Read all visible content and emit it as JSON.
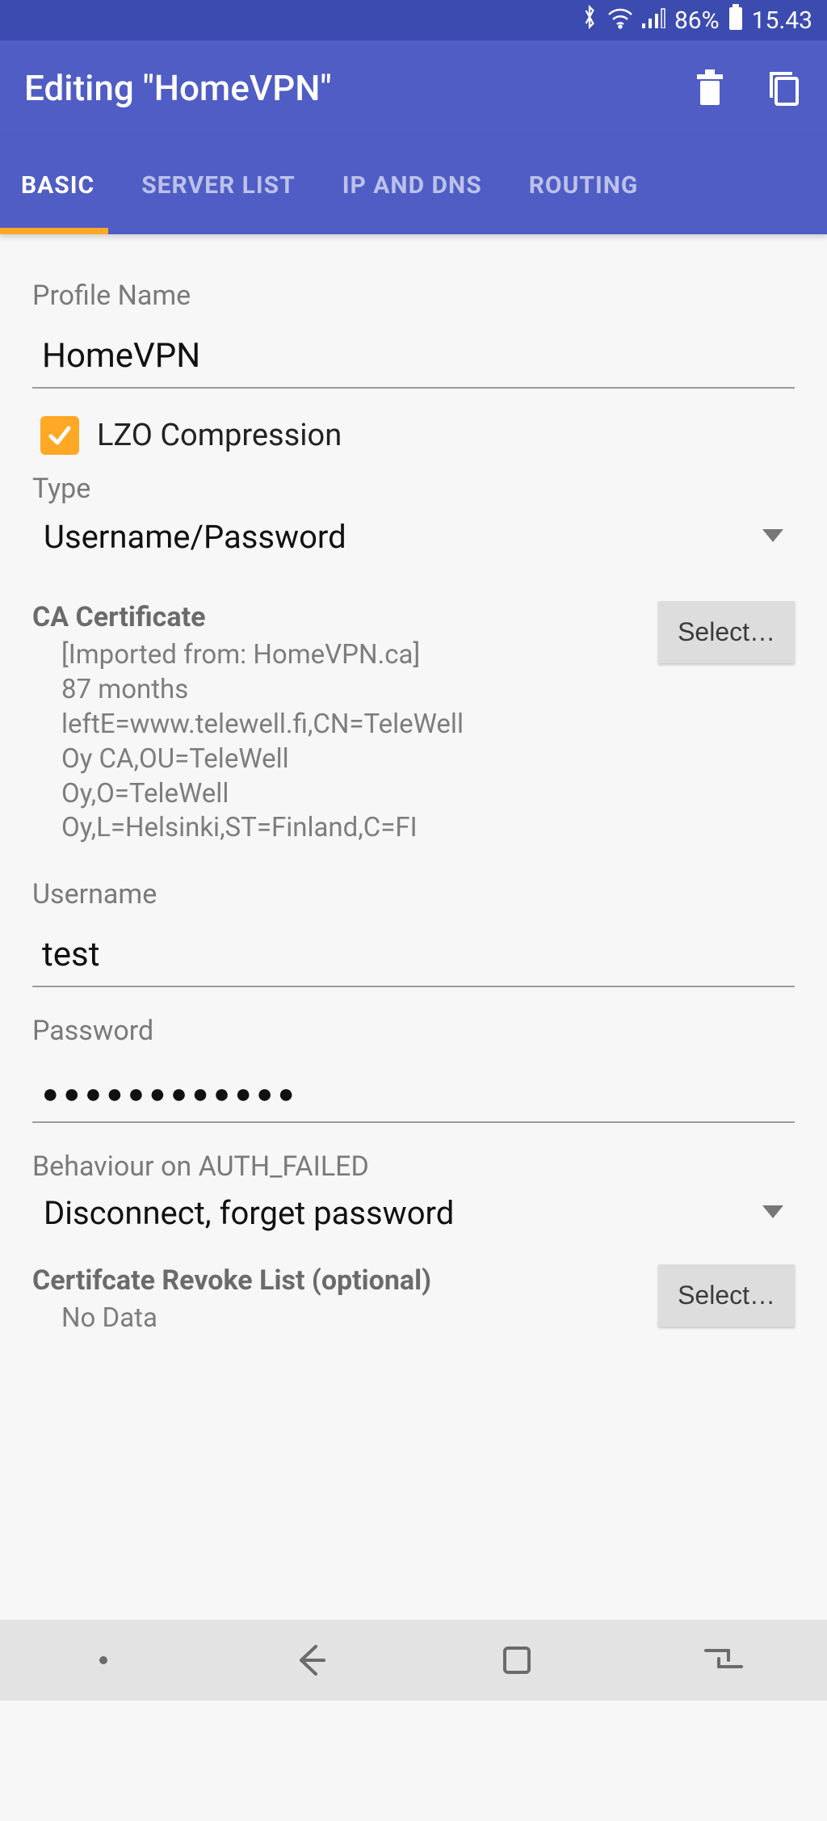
{
  "status": {
    "battery_pct": "86%",
    "time": "15.43"
  },
  "appbar": {
    "title": "Editing \"HomeVPN\""
  },
  "tabs": {
    "basic": "BASIC",
    "server_list": "SERVER LIST",
    "ip_dns": "IP AND DNS",
    "routing": "ROUTING"
  },
  "form": {
    "profile_name_label": "Profile Name",
    "profile_name_value": "HomeVPN",
    "lzo_label": "LZO Compression",
    "type_label": "Type",
    "type_value": "Username/Password",
    "ca_label": "CA Certificate",
    "ca_sub1": "[Imported from: HomeVPN.ca]",
    "ca_sub2": "87 months leftE=www.telewell.fi,CN=TeleWell Oy CA,OU=TeleWell Oy,O=TeleWell Oy,L=Helsinki,ST=Finland,C=FI",
    "select_btn": "Select…",
    "username_label": "Username",
    "username_value": "test",
    "password_label": "Password",
    "password_value": "●●●●●●●●●●●●",
    "auth_failed_label": "Behaviour on AUTH_FAILED",
    "auth_failed_value": "Disconnect, forget password",
    "crl_label": "Certifcate Revoke List (optional)",
    "crl_value": "No Data"
  }
}
